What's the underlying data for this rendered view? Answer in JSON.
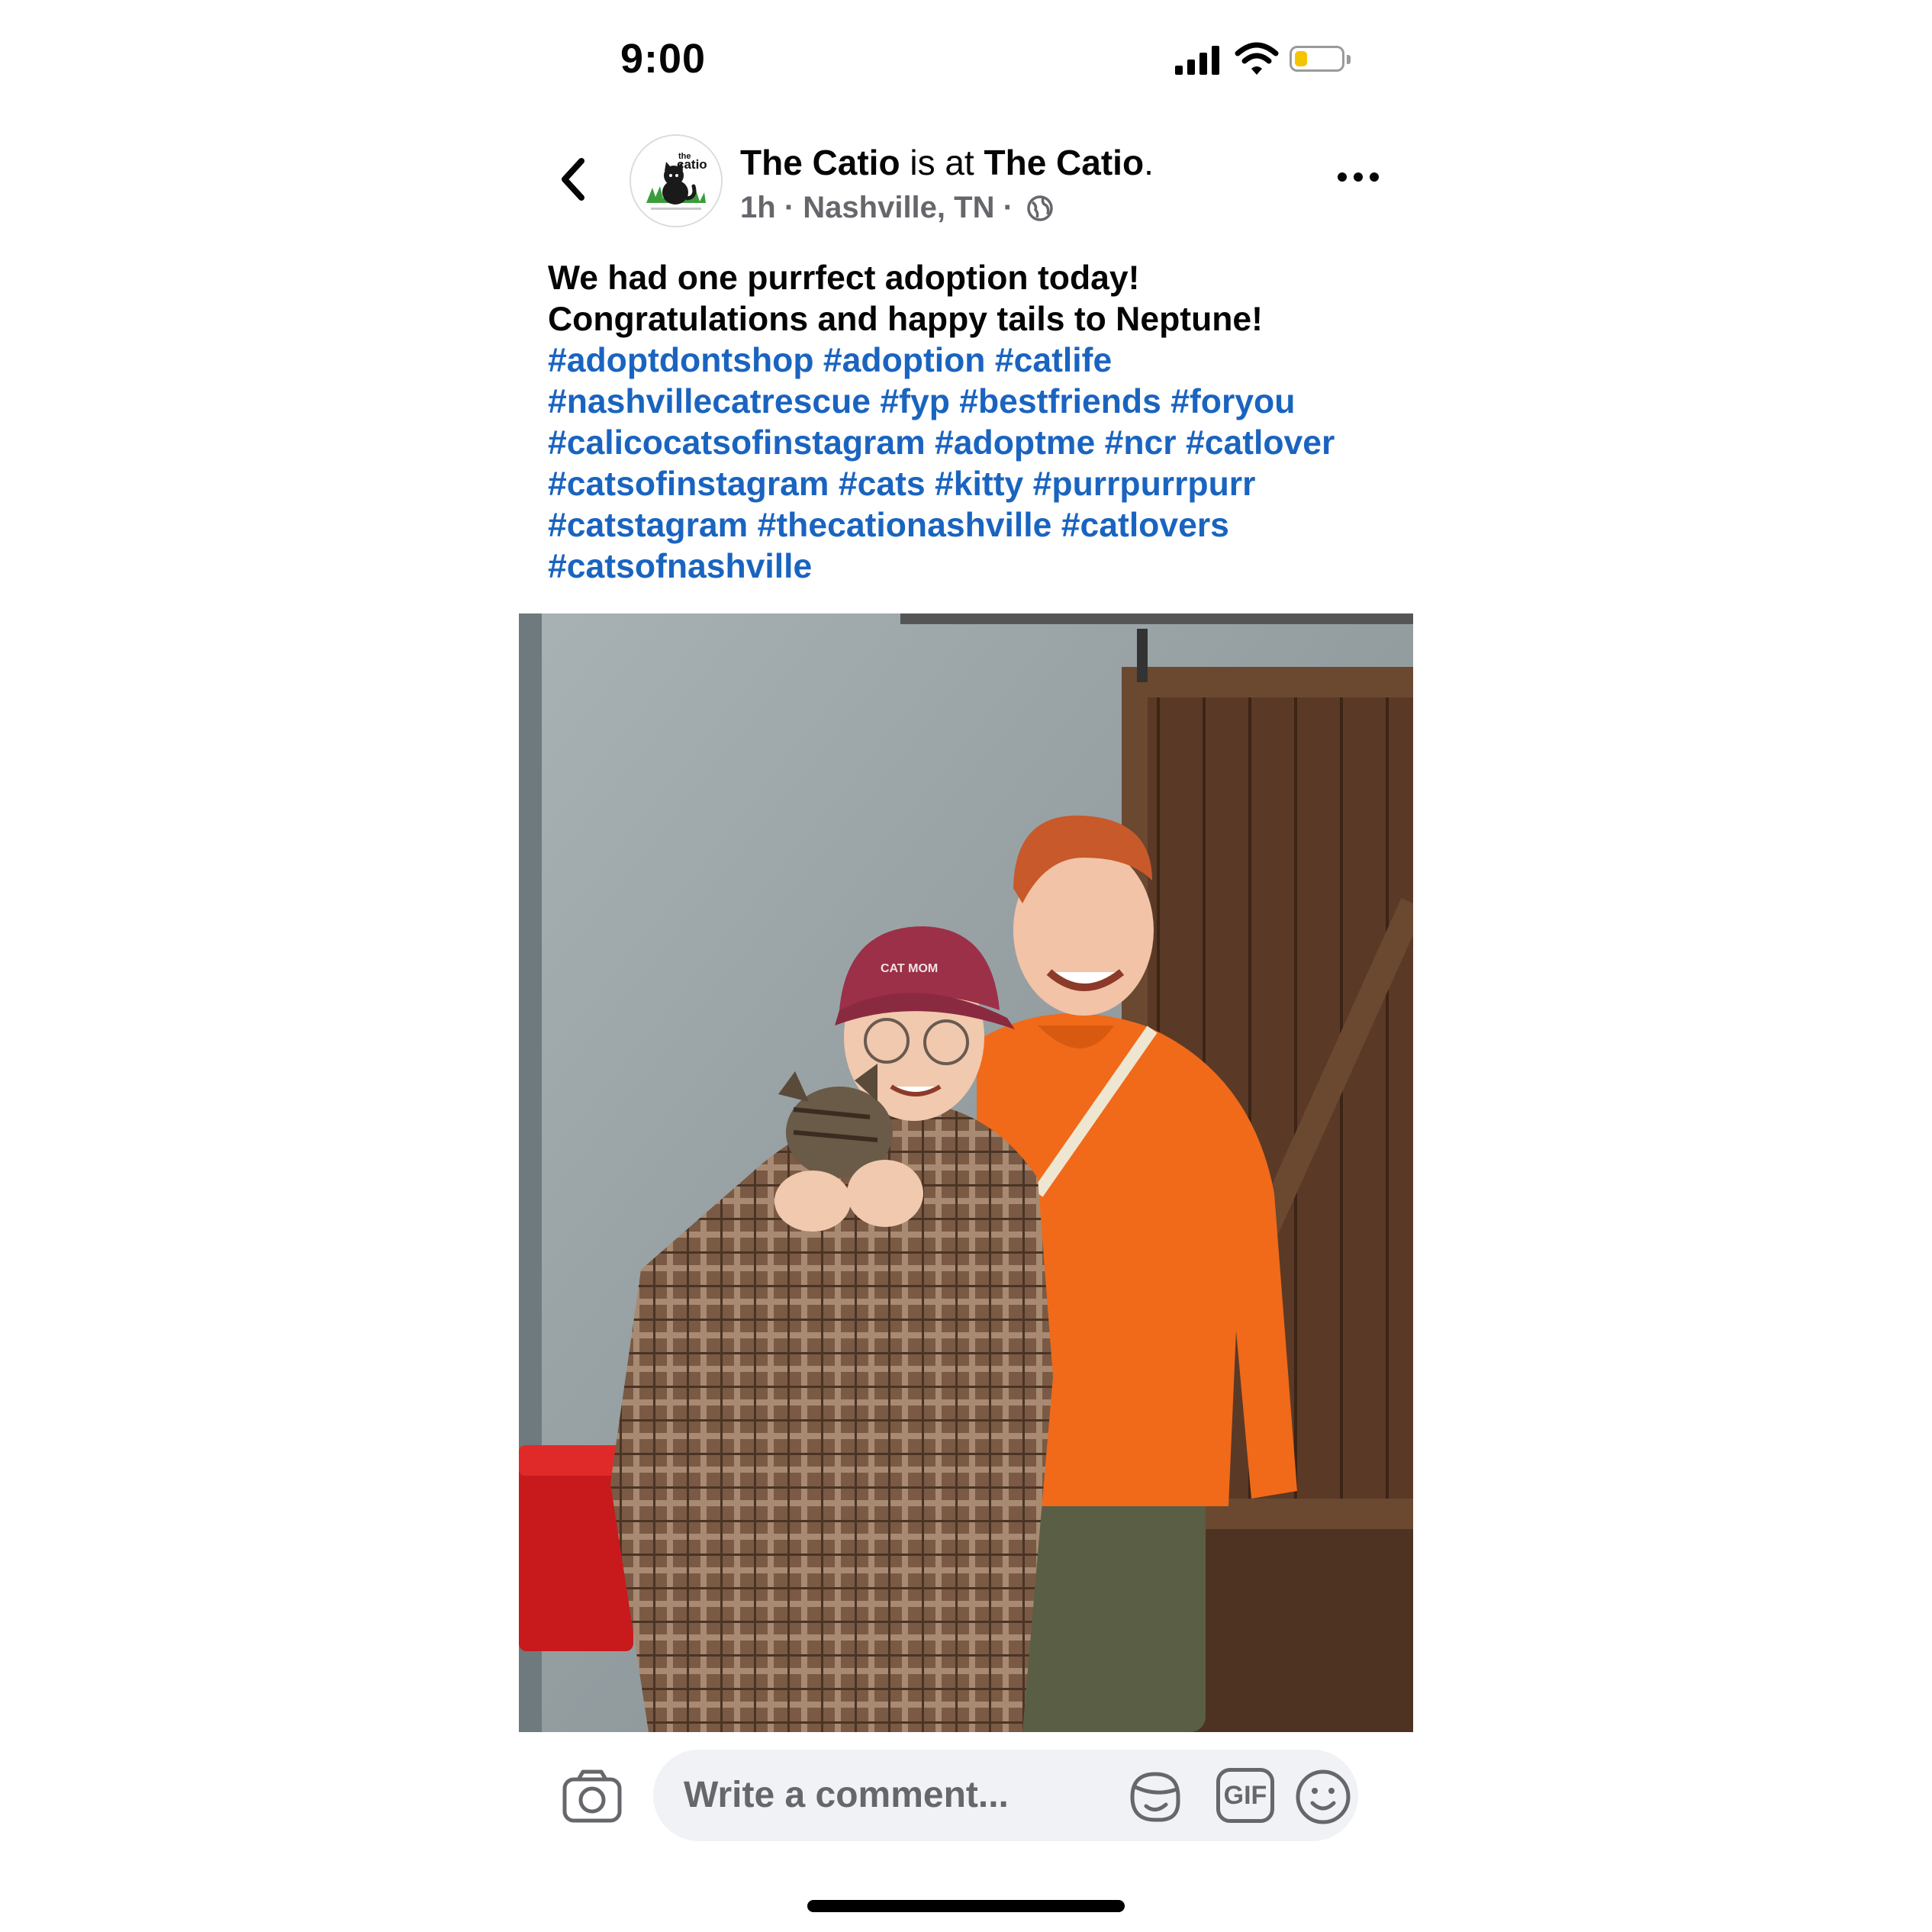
{
  "status_bar": {
    "time": "9:00"
  },
  "post": {
    "page_name": "The Catio",
    "verb": "is at",
    "location_name": "The Catio",
    "time_ago": "1h",
    "place": "Nashville, TN",
    "separator": "·",
    "avatar_text_top": "the",
    "avatar_text_main": "catio",
    "caption_lines": [
      "We had one purrfect adoption today!",
      "Congratulations and happy tails to Neptune!"
    ],
    "hashtag_lines": [
      [
        " #adoptdontshop",
        " #adoption",
        " #catlife"
      ],
      [
        "#nashvillecatrescue",
        " #fyp",
        " #bestfriends",
        " #foryou"
      ],
      [
        "#calicocatsofinstagram",
        " #adoptme",
        " #ncr",
        " #catlover"
      ],
      [
        "#catsofinstagram",
        " #cats",
        " #kitty",
        " #purrpurrpurr"
      ],
      [
        "#catstagram",
        " #thecationashville",
        " #catlovers"
      ],
      [
        "#catsofnashville"
      ]
    ],
    "photo_cap_text": "CAT MOM"
  },
  "comment_bar": {
    "placeholder": "Write a comment...",
    "gif_label": "GIF"
  },
  "colors": {
    "hashtag": "#1a64c0",
    "secondary_text": "#65676b",
    "comment_bg": "#f0f2f5",
    "battery_fill": "#f5c400"
  },
  "icons": [
    "back-arrow-icon",
    "more-dots-icon",
    "globe-icon",
    "camera-icon",
    "sticker-icon",
    "gif-icon",
    "emoji-icon",
    "signal-icon",
    "wifi-icon",
    "battery-icon"
  ]
}
